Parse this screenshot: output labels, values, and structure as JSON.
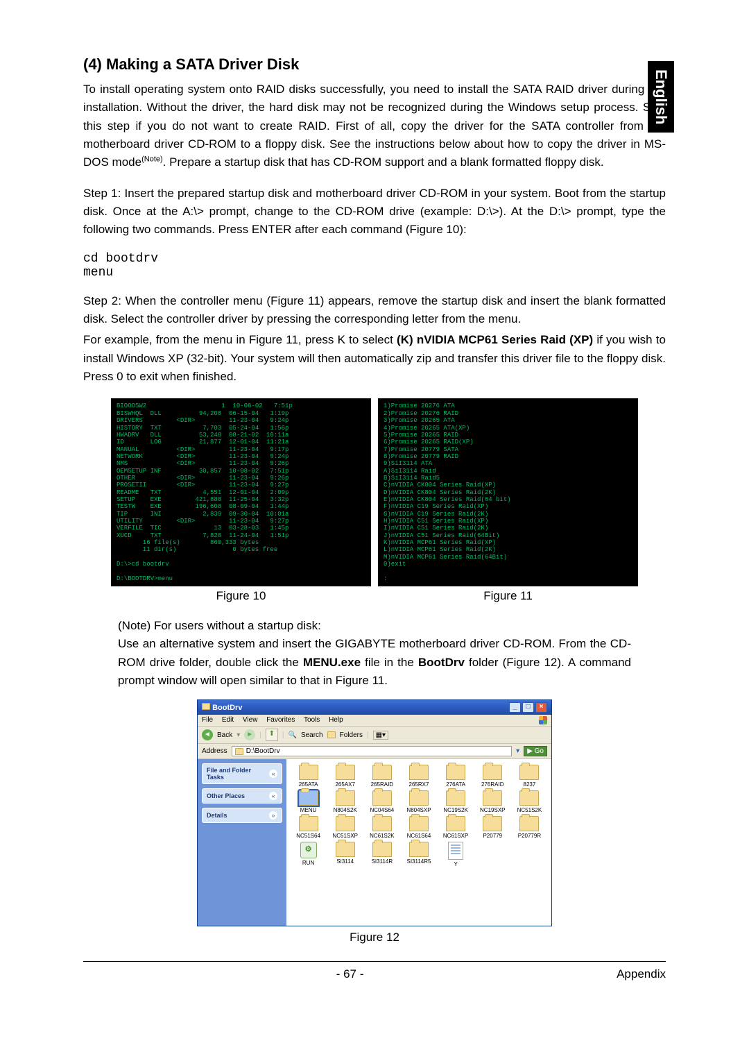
{
  "language_tab": "English",
  "section_title": "(4)   Making a SATA Driver Disk",
  "p1": "To install operating system onto RAID disks successfully, you need to install the SATA RAID driver during OS installation. Without the driver, the hard disk may not be recognized during the Windows setup process.  Skip this step if you do not want to create RAID. First of all, copy the driver for the SATA controller from the motherboard driver CD-ROM to a floppy disk. See the instructions below about how to copy the driver in MS-DOS mode",
  "p1_note_sup": "(Note)",
  "p1_tail": ". Prepare a startup disk that has CD-ROM support and a blank formatted floppy disk.",
  "p2": "Step 1: Insert the prepared startup disk and motherboard driver CD-ROM in your system.  Boot from the startup disk. Once at the A:\\> prompt, change to the CD-ROM drive (example: D:\\>).  At the D:\\> prompt, type the following two commands. Press ENTER after each command (Figure 10):",
  "cmd": "cd bootdrv\nmenu",
  "p3": "Step 2: When the controller menu (Figure 11) appears, remove the startup disk and insert the blank formatted disk.  Select the controller driver by pressing the corresponding letter from the menu.",
  "p4a": "For example, from the menu in Figure 11, press K to select ",
  "p4b": "(K) nVIDIA MCP61 Series Raid (XP)",
  "p4c": " if you wish to install Windows XP (32-bit). Your system will then automatically zip and transfer this driver file to the floppy disk.  Press 0 to exit when finished.",
  "fig10_lines": "BIOOOSW2                    1  10-08-02   7:51p\nBISWHQL  DLL          94,208  06-15-04   1:19p\nDRIVERS         <DIR>         11-23-04   9:24p\nHISTORY  TXT           7,703  05-24-04   1:56p\nHWADRV   DLL          53,248  08-21-02  10:11a\nID       LOG          21,877  12-01-04  11:21a\nMANUAL          <DIR>         11-23-04   9:17p\nNETWORK         <DIR>         11-23-04   9:24p\nNMS             <DIR>         11-23-04   9:26p\nOEMSETUP INF          30,857  10-08-02   7:51p\nOTHER           <DIR>         11-23-04   9:26p\nPROSETII        <DIR>         11-23-04   9:27p\nREADME   TXT           4,551  12-01-04   2:09p\nSETUP    EXE         421,888  11-25-04   3:32p\nTESTW    EXE         196,608  08-09-04   1:44p\nTIP      INI           2,839  09-30-04  10:01a\nUTILITY         <DIR>         11-23-04   9:27p\nVERFILE  TIC              13  03-28-03   1:45p\nXUCD     TXT           7,828  11-24-04   1:51p\n       16 file(s)        860,333 bytes\n       11 dir(s)               0 bytes free\n\nD:\\>cd bootdrv\n\nD:\\BOOTDRV>menu",
  "fig11_lines": "1)Promise 20276 ATA\n2)Promise 20276 RAID\n3)Promise 20265 ATA\n4)Promise 20265 ATA(XP)\n5)Promise 20265 RAID\n6)Promise 20265 RAID(XP)\n7)Promise 20779 SATA\n8)Promise 20779 RAID\n9)SiI3114 ATA\nA)SiI3114 Raid\nB)SiI3114 Raid5\nC)nVIDIA CK804 Series Raid(XP)\nD)nVIDIA CK804 Series Raid(2K)\nE)nVIDIA CK804 Series Raid(64 bit)\nF)nVIDIA C19 Series Raid(XP)\nG)nVIDIA C19 Series Raid(2K)\nH)nVIDIA C51 Series Raid(XP)\nI)nVIDIA C51 Series Raid(2K)\nJ)nVIDIA C51 Series Raid(64Bit)\nK)nVIDIA MCP61 Series Raid(XP)\nL)nVIDIA MCP61 Series Raid(2K)\nM)nVIDIA MCP61 Series Raid(64Bit)\n0)exit\n\n:",
  "fig10_cap": "Figure 10",
  "fig11_cap": "Figure 11",
  "note_head": "(Note) For users without a startup disk:",
  "note_body_a": "Use an alternative system and insert the GIGABYTE motherboard driver CD-ROM.  From the CD-ROM drive folder, double click the ",
  "note_body_b": "MENU.exe",
  "note_body_c": " file in the ",
  "note_body_d": "BootDrv",
  "note_body_e": " folder (Figure 12). A command prompt window will open similar to that in Figure 11.",
  "explorer": {
    "title": "BootDrv",
    "menu": {
      "file": "File",
      "edit": "Edit",
      "view": "View",
      "fav": "Favorites",
      "tools": "Tools",
      "help": "Help"
    },
    "toolbar": {
      "back": "Back",
      "search": "Search",
      "folders": "Folders"
    },
    "addr_label": "Address",
    "addr_value": "D:\\BootDrv",
    "go": "Go",
    "panels": {
      "tasks": "File and Folder Tasks",
      "places": "Other Places",
      "details": "Details"
    },
    "files": [
      {
        "name": "265ATA",
        "type": "folder"
      },
      {
        "name": "265AX7",
        "type": "folder"
      },
      {
        "name": "265RAID",
        "type": "folder"
      },
      {
        "name": "265RX7",
        "type": "folder"
      },
      {
        "name": "276ATA",
        "type": "folder"
      },
      {
        "name": "276RAID",
        "type": "folder"
      },
      {
        "name": "8237",
        "type": "folder"
      },
      {
        "name": "MENU",
        "type": "folder",
        "sel": true
      },
      {
        "name": "N804S2K",
        "type": "folder"
      },
      {
        "name": "NC04S64",
        "type": "folder"
      },
      {
        "name": "N804SXP",
        "type": "folder"
      },
      {
        "name": "NC19S2K",
        "type": "folder"
      },
      {
        "name": "NC19SXP",
        "type": "folder"
      },
      {
        "name": "NC51S2K",
        "type": "folder"
      },
      {
        "name": "NC51S64",
        "type": "folder"
      },
      {
        "name": "NC51SXP",
        "type": "folder"
      },
      {
        "name": "NC61S2K",
        "type": "folder"
      },
      {
        "name": "NC61S64",
        "type": "folder"
      },
      {
        "name": "NC61SXP",
        "type": "folder"
      },
      {
        "name": "P20779",
        "type": "folder"
      },
      {
        "name": "P20779R",
        "type": "folder"
      },
      {
        "name": "RUN",
        "type": "exe"
      },
      {
        "name": "SI3114",
        "type": "folder"
      },
      {
        "name": "SI3114R",
        "type": "folder"
      },
      {
        "name": "SI3114R5",
        "type": "folder"
      },
      {
        "name": "Y",
        "type": "txt"
      }
    ]
  },
  "fig12_cap": "Figure 12",
  "footer": {
    "page": "- 67 -",
    "section": "Appendix"
  }
}
